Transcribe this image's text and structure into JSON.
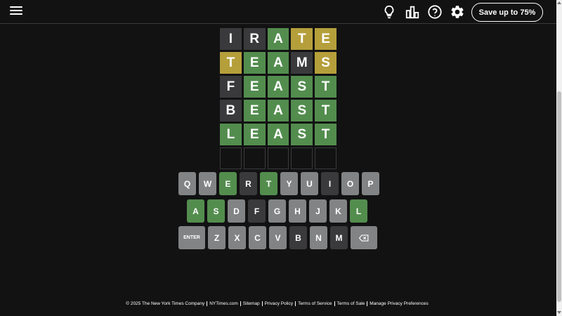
{
  "header": {
    "menu_icon": "hamburger-icon",
    "hint_icon": "lightbulb-icon",
    "stats_icon": "bar-chart-icon",
    "help_icon": "question-mark-icon",
    "settings_icon": "gear-icon",
    "save_button_label": "Save up to 75%"
  },
  "board": {
    "rows": [
      {
        "tiles": [
          {
            "letter": "I",
            "state": "absent"
          },
          {
            "letter": "R",
            "state": "absent"
          },
          {
            "letter": "A",
            "state": "correct"
          },
          {
            "letter": "T",
            "state": "present"
          },
          {
            "letter": "E",
            "state": "present"
          }
        ]
      },
      {
        "tiles": [
          {
            "letter": "T",
            "state": "present"
          },
          {
            "letter": "E",
            "state": "correct"
          },
          {
            "letter": "A",
            "state": "correct"
          },
          {
            "letter": "M",
            "state": "absent"
          },
          {
            "letter": "S",
            "state": "present"
          }
        ]
      },
      {
        "tiles": [
          {
            "letter": "F",
            "state": "absent"
          },
          {
            "letter": "E",
            "state": "correct"
          },
          {
            "letter": "A",
            "state": "correct"
          },
          {
            "letter": "S",
            "state": "correct"
          },
          {
            "letter": "T",
            "state": "correct"
          }
        ]
      },
      {
        "tiles": [
          {
            "letter": "B",
            "state": "absent"
          },
          {
            "letter": "E",
            "state": "correct"
          },
          {
            "letter": "A",
            "state": "correct"
          },
          {
            "letter": "S",
            "state": "correct"
          },
          {
            "letter": "T",
            "state": "correct"
          }
        ]
      },
      {
        "tiles": [
          {
            "letter": "L",
            "state": "correct"
          },
          {
            "letter": "E",
            "state": "correct"
          },
          {
            "letter": "A",
            "state": "correct"
          },
          {
            "letter": "S",
            "state": "correct"
          },
          {
            "letter": "T",
            "state": "correct"
          }
        ]
      },
      {
        "tiles": [
          {
            "letter": "",
            "state": "empty"
          },
          {
            "letter": "",
            "state": "empty"
          },
          {
            "letter": "",
            "state": "empty"
          },
          {
            "letter": "",
            "state": "empty"
          },
          {
            "letter": "",
            "state": "empty"
          }
        ]
      }
    ]
  },
  "keyboard": {
    "rows": [
      [
        {
          "key": "Q",
          "state": "unused"
        },
        {
          "key": "W",
          "state": "unused"
        },
        {
          "key": "E",
          "state": "correct"
        },
        {
          "key": "R",
          "state": "absent"
        },
        {
          "key": "T",
          "state": "correct"
        },
        {
          "key": "Y",
          "state": "unused"
        },
        {
          "key": "U",
          "state": "unused"
        },
        {
          "key": "I",
          "state": "absent"
        },
        {
          "key": "O",
          "state": "unused"
        },
        {
          "key": "P",
          "state": "unused"
        }
      ],
      [
        {
          "key": "A",
          "state": "correct"
        },
        {
          "key": "S",
          "state": "correct"
        },
        {
          "key": "D",
          "state": "unused"
        },
        {
          "key": "F",
          "state": "absent"
        },
        {
          "key": "G",
          "state": "unused"
        },
        {
          "key": "H",
          "state": "unused"
        },
        {
          "key": "J",
          "state": "unused"
        },
        {
          "key": "K",
          "state": "unused"
        },
        {
          "key": "L",
          "state": "correct"
        }
      ],
      [
        {
          "key": "ENTER",
          "state": "unused"
        },
        {
          "key": "Z",
          "state": "unused"
        },
        {
          "key": "X",
          "state": "unused"
        },
        {
          "key": "C",
          "state": "unused"
        },
        {
          "key": "V",
          "state": "unused"
        },
        {
          "key": "B",
          "state": "absent"
        },
        {
          "key": "N",
          "state": "unused"
        },
        {
          "key": "M",
          "state": "absent"
        },
        {
          "key": "",
          "state": "unused",
          "icon": "backspace-icon"
        }
      ]
    ]
  },
  "footer": {
    "copyright": "© 2025 The New York Times Company",
    "links": [
      "NYTimes.com",
      "Sitemap",
      "Privacy Policy",
      "Terms of Service",
      "Terms of Sale",
      "Manage Privacy Preferences"
    ]
  },
  "colors": {
    "correct": "#538d4e",
    "present": "#b59f3b",
    "absent": "#3a3a3c",
    "unused_key": "#818384",
    "background": "#121213"
  }
}
